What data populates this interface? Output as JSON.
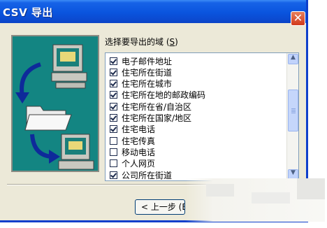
{
  "dialog": {
    "title": "CSV 导出",
    "close_symbol": "✕"
  },
  "fields_label": "选择要导出的域 (",
  "fields_hotkey": "S",
  "fields_label_end": ")",
  "fields": [
    {
      "label": "电子邮件地址",
      "checked": true
    },
    {
      "label": "住宅所在街道",
      "checked": true
    },
    {
      "label": "住宅所在城市",
      "checked": true
    },
    {
      "label": "住宅所在地的邮政编码",
      "checked": true
    },
    {
      "label": "住宅所在省/自治区",
      "checked": true
    },
    {
      "label": "住宅所在国家/地区",
      "checked": true
    },
    {
      "label": "住宅电话",
      "checked": true
    },
    {
      "label": "住宅传真",
      "checked": false
    },
    {
      "label": "移动电话",
      "checked": false
    },
    {
      "label": "个人网页",
      "checked": false
    },
    {
      "label": "公司所在街道",
      "checked": true
    }
  ],
  "scroll": {
    "up": "▲",
    "down": "▼"
  },
  "buttons": {
    "back": "< 上一步 (B"
  },
  "icons": [
    "computer-icon",
    "folder-icon",
    "arrow-icon"
  ],
  "colors": {
    "titlebar": "#0a54de",
    "panel": "#138582",
    "dialog": "#ece9d8"
  }
}
